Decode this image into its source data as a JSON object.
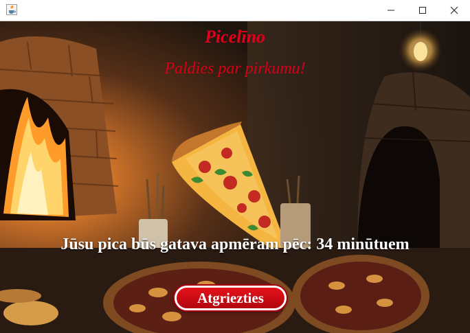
{
  "window": {
    "app_icon": "java-cup-icon",
    "minimize_icon": "minimize-icon",
    "maximize_icon": "maximize-icon",
    "close_icon": "close-icon"
  },
  "content": {
    "brand": "Picelīno",
    "thanks": "Paldies par pirkumu!",
    "message": "Jūsu pica būs gatava apmēram pēc: 34 minūtuem",
    "back_button": "Atgriezties"
  },
  "colors": {
    "brand": "#e0001b",
    "button": "#d10b13",
    "message": "#ffffff"
  }
}
